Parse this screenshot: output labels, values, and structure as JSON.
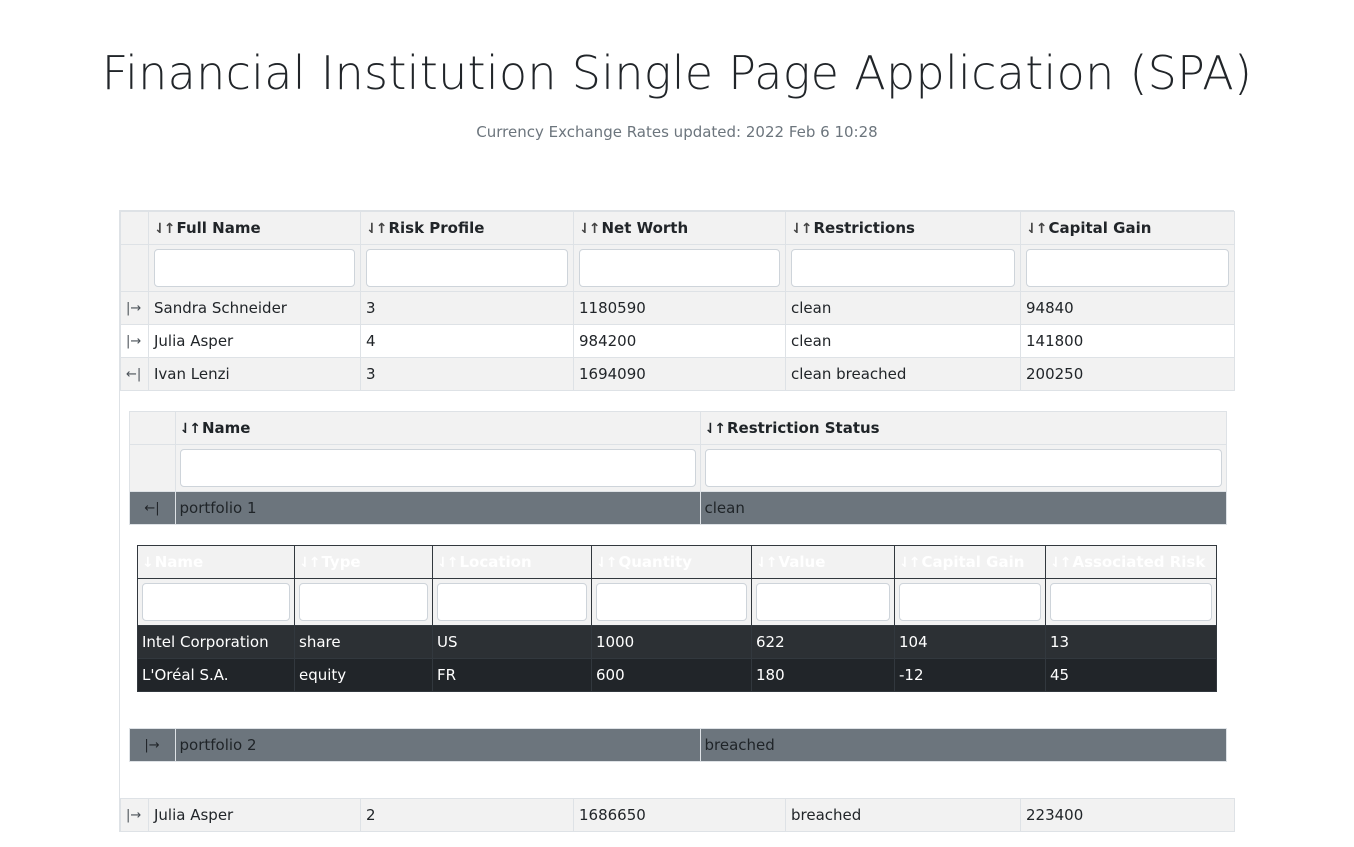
{
  "header": {
    "title": "Financial Institution Single Page Application (SPA)",
    "subtitle": "Currency Exchange Rates updated: 2022 Feb 6 10:28"
  },
  "icons": {
    "sort_both": "⇃↑",
    "sort_down": "↓",
    "expand": "|→",
    "collapse": "←|"
  },
  "clients": {
    "columns": [
      "Full Name",
      "Risk Profile",
      "Net Worth",
      "Restrictions",
      "Capital Gain"
    ],
    "rows": [
      {
        "name": "Sandra Schneider",
        "risk": "3",
        "net_worth": "1180590",
        "restrictions": "clean",
        "capital_gain": "94840"
      },
      {
        "name": "Julia Asper",
        "risk": "4",
        "net_worth": "984200",
        "restrictions": "clean",
        "capital_gain": "141800"
      },
      {
        "name": "Ivan Lenzi",
        "risk": "3",
        "net_worth": "1694090",
        "restrictions": "clean breached",
        "capital_gain": "200250"
      },
      {
        "name": "Julia Asper",
        "risk": "2",
        "net_worth": "1686650",
        "restrictions": "breached",
        "capital_gain": "223400"
      }
    ]
  },
  "portfolios": {
    "columns": [
      "Name",
      "Restriction Status"
    ],
    "rows": [
      {
        "name": "portfolio 1",
        "status": "clean"
      },
      {
        "name": "portfolio 2",
        "status": "breached"
      }
    ]
  },
  "holdings": {
    "columns": [
      "Name",
      "Type",
      "Location",
      "Quantity",
      "Value",
      "Capital Gain",
      "Associated Risk"
    ],
    "rows": [
      {
        "name": "Intel Corporation",
        "type": "share",
        "location": "US",
        "quantity": "1000",
        "value": "622",
        "capital_gain": "104",
        "risk": "13"
      },
      {
        "name": "L'Oréal S.A.",
        "type": "equity",
        "location": "FR",
        "quantity": "600",
        "value": "180",
        "capital_gain": "-12",
        "risk": "45"
      }
    ]
  },
  "colors": {
    "row_stripe": "#f2f2f2",
    "nested_level_2": "#6c757d",
    "nested_level_3": "#212529"
  }
}
